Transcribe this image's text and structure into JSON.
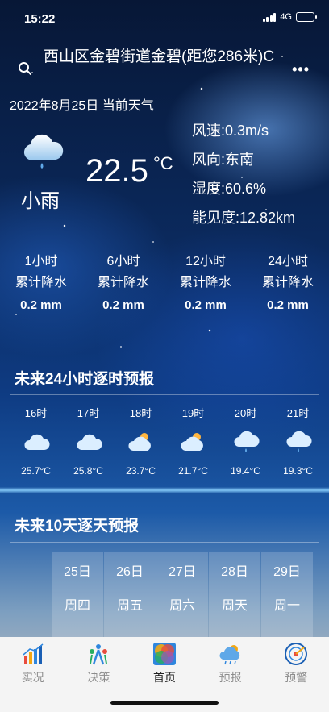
{
  "status_bar": {
    "time": "15:22",
    "network": "4G"
  },
  "header": {
    "location": "西山区金碧街道金碧(距您286米)C",
    "date_line": "2022年8月25日 当前天气",
    "search_icon": "search-icon",
    "more_icon": "more-icon"
  },
  "current": {
    "condition": "小雨",
    "temperature": "22.5",
    "unit": "°C",
    "wind_speed": "风速:0.3m/s",
    "wind_direction": "风向:东南",
    "humidity": "湿度:60.6%",
    "visibility": "能见度:12.82km",
    "icon": "light-rain-icon"
  },
  "precipitation": [
    {
      "period": "1小时",
      "label": "累计降水",
      "value": "0.2 mm"
    },
    {
      "period": "6小时",
      "label": "累计降水",
      "value": "0.2 mm"
    },
    {
      "period": "12小时",
      "label": "累计降水",
      "value": "0.2 mm"
    },
    {
      "period": "24小时",
      "label": "累计降水",
      "value": "0.2 mm"
    }
  ],
  "hourly": {
    "title": "未来24小时逐时预报",
    "items": [
      {
        "hour": "16时",
        "icon": "cloudy-icon",
        "temp": "25.7°C"
      },
      {
        "hour": "17时",
        "icon": "cloudy-icon",
        "temp": "25.8°C"
      },
      {
        "hour": "18时",
        "icon": "partly-cloudy-icon",
        "temp": "23.7°C"
      },
      {
        "hour": "19时",
        "icon": "partly-cloudy-icon",
        "temp": "21.7°C"
      },
      {
        "hour": "20时",
        "icon": "light-rain-icon",
        "temp": "19.4°C"
      },
      {
        "hour": "21时",
        "icon": "light-rain-icon",
        "temp": "19.3°C"
      }
    ]
  },
  "daily": {
    "title": "未来10天逐天预报",
    "items": [
      {
        "date": "25日",
        "weekday": "周四"
      },
      {
        "date": "26日",
        "weekday": "周五"
      },
      {
        "date": "27日",
        "weekday": "周六"
      },
      {
        "date": "28日",
        "weekday": "周天"
      },
      {
        "date": "29日",
        "weekday": "周一"
      }
    ]
  },
  "tabs": [
    {
      "label": "实况",
      "icon": "bar-chart-icon",
      "active": false
    },
    {
      "label": "决策",
      "icon": "decision-people-icon",
      "active": false
    },
    {
      "label": "首页",
      "icon": "home-icon",
      "active": true
    },
    {
      "label": "预报",
      "icon": "forecast-icon",
      "active": false
    },
    {
      "label": "预警",
      "icon": "warning-radar-icon",
      "active": false
    }
  ],
  "colors": {
    "accent_active": "#222222",
    "tab_inactive": "#8c8c8c",
    "battery": "#3fd65c"
  }
}
